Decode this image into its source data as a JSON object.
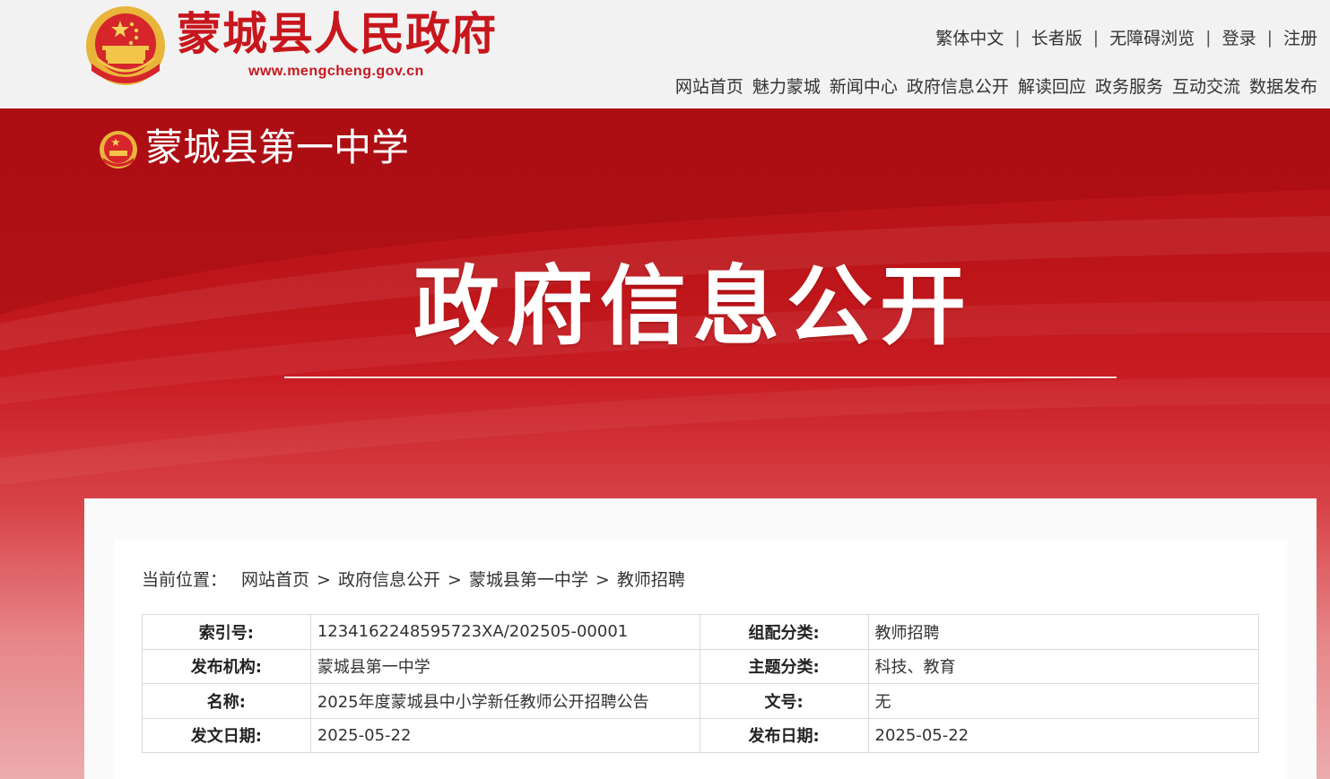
{
  "header": {
    "site_title": "蒙城县人民政府",
    "site_url": "www.mengcheng.gov.cn",
    "utility_links": [
      "繁体中文",
      "长者版",
      "无障碍浏览",
      "登录",
      "注册"
    ],
    "utility_separator": "|",
    "nav_items": [
      "网站首页",
      "魅力蒙城",
      "新闻中心",
      "政府信息公开",
      "解读回应",
      "政务服务",
      "互动交流",
      "数据发布"
    ]
  },
  "banner": {
    "org_name": "蒙城县第一中学",
    "title": "政府信息公开"
  },
  "breadcrumb": {
    "prefix": "当前位置：",
    "separator": ">",
    "items": [
      "网站首页",
      "政府信息公开",
      "蒙城县第一中学",
      "教师招聘"
    ]
  },
  "meta": {
    "rows": [
      {
        "label1": "索引号:",
        "value1": "1234162248595723XA/202505-00001",
        "label2": "组配分类:",
        "value2": "教师招聘"
      },
      {
        "label1": "发布机构:",
        "value1": "蒙城县第一中学",
        "label2": "主题分类:",
        "value2": "科技、教育"
      },
      {
        "label1": "名称:",
        "value1": "2025年度蒙城县中小学新任教师公开招聘公告",
        "label2": "文号:",
        "value2": "无"
      },
      {
        "label1": "发文日期:",
        "value1": "2025-05-22",
        "label2": "发布日期:",
        "value2": "2025-05-22"
      }
    ]
  },
  "colors": {
    "brand_red": "#c8161d",
    "emblem_gold": "#e8b53a",
    "banner_red": "#b71116"
  },
  "icons": {
    "header_emblem": "national-emblem-icon",
    "banner_emblem": "national-emblem-icon"
  }
}
